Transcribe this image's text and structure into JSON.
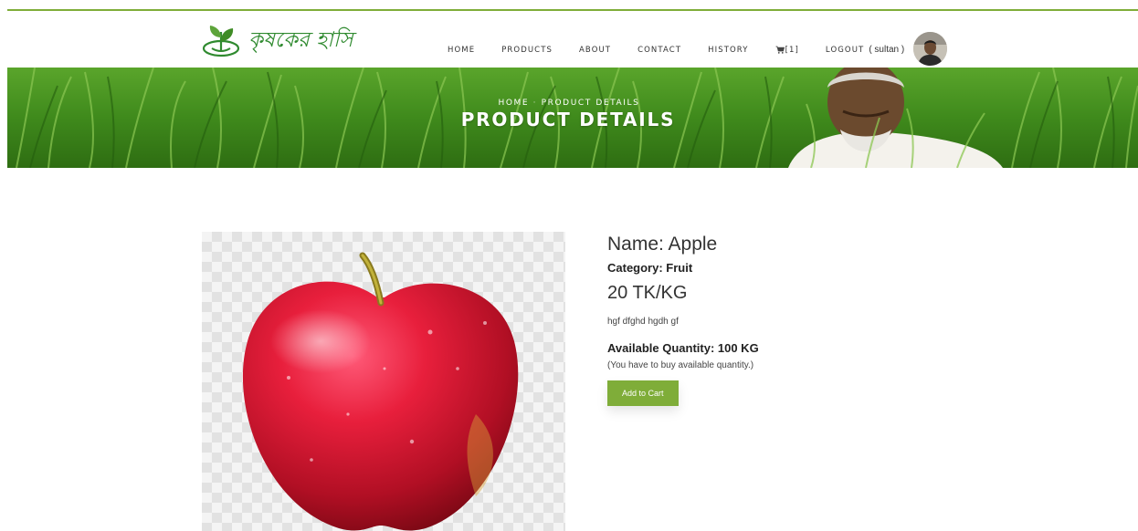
{
  "brand": {
    "name": "কৃষকের হাসি"
  },
  "nav": {
    "items": [
      {
        "label": "HOME"
      },
      {
        "label": "PRODUCTS"
      },
      {
        "label": "ABOUT"
      },
      {
        "label": "CONTACT"
      },
      {
        "label": "HISTORY"
      }
    ],
    "cart": {
      "label": "[1]",
      "icon": "cart-icon"
    },
    "logout": "LOGOUT",
    "user": "( sultan )"
  },
  "hero": {
    "breadcrumb": {
      "home": "HOME",
      "current": "PRODUCT DETAILS"
    },
    "title": "PRODUCT DETAILS"
  },
  "product": {
    "name_line": "Name: Apple",
    "category_line": "Category: Fruit",
    "price_line": "20 TK/KG",
    "description": "hgf dfghd hgdh gf",
    "quantity_line": "Available Quantity: 100 KG",
    "quantity_note": "(You have to buy available quantity.)",
    "add_to_cart_label": "Add to Cart"
  },
  "colors": {
    "accent": "#7fad39",
    "brand_green": "#2f8a2f"
  }
}
